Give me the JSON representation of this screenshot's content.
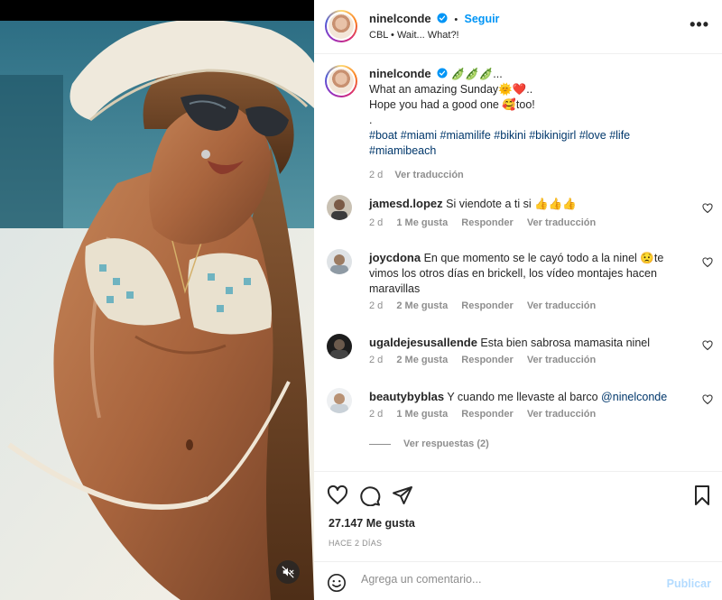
{
  "post": {
    "author": "ninelconde",
    "follow_label": "Seguir",
    "dot": "•",
    "audio": "CBL • Wait... What?!",
    "more_label": "•••",
    "caption": {
      "line1": "🫛🫛🫛...",
      "line2a": "What an amazing Sunday",
      "line2b": "🌞❤️..",
      "line3a": "Hope you had a good one ",
      "line3b": "🥰too!",
      "line4": ".",
      "hashtags": [
        "#boat",
        "#miami",
        "#miamilife",
        "#bikini",
        "#bikinigirl",
        "#love",
        "#life",
        "#miamibeach"
      ],
      "time": "2 d",
      "translate": "Ver traducción"
    }
  },
  "comments": [
    {
      "user": "jamesd.lopez",
      "text": "Si viendote a ti si 👍👍👍",
      "time": "2 d",
      "likes": "1 Me gusta",
      "reply": "Responder",
      "translate": "Ver traducción"
    },
    {
      "user": "joycdona",
      "text": "En que momento se le cayó todo a la ninel 😟te vimos los otros días en brickell, los vídeo montajes hacen maravillas",
      "time": "2 d",
      "likes": "2 Me gusta",
      "reply": "Responder",
      "translate": "Ver traducción"
    },
    {
      "user": "ugaldejesusallende",
      "text": "Esta bien sabrosa mamasita ninel",
      "time": "2 d",
      "likes": "2 Me gusta",
      "reply": "Responder",
      "translate": "Ver traducción"
    },
    {
      "user": "beautybyblas",
      "text": "Y cuando me llevaste al barco ",
      "mention": "@ninelconde",
      "time": "2 d",
      "likes": "1 Me gusta",
      "reply": "Responder",
      "translate": "Ver traducción"
    }
  ],
  "view_replies": "Ver respuestas (2)",
  "likes_count": "27.147 Me gusta",
  "posted_ago": "HACE 2 DÍAS",
  "composer": {
    "placeholder": "Agrega un comentario...",
    "publish": "Publicar"
  }
}
